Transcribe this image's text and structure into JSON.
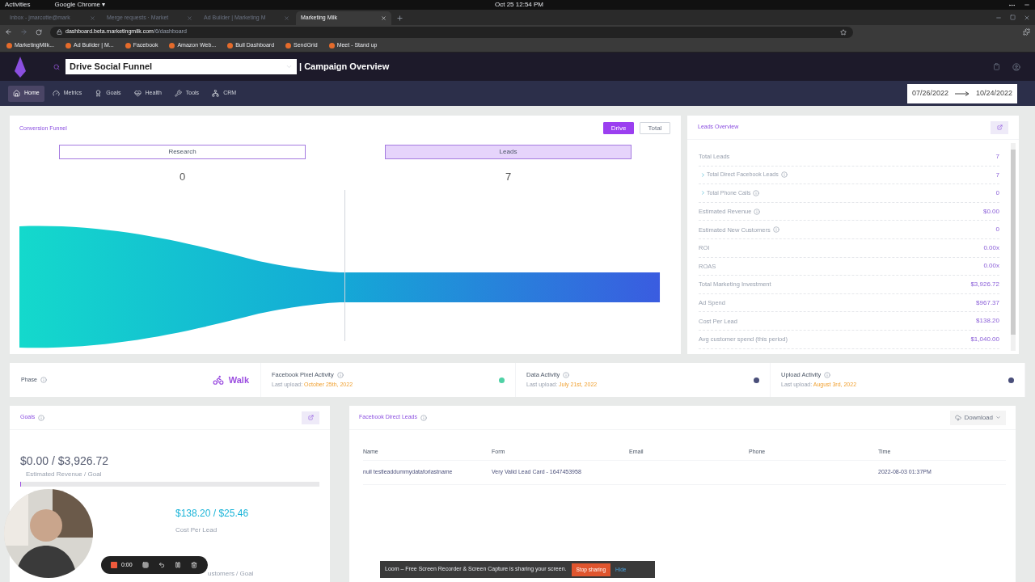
{
  "os_bar": {
    "activities": "Activities",
    "app": "Google Chrome",
    "app_caret": "▾",
    "clock": "Oct 25  12:54 PM"
  },
  "browser": {
    "tabs": [
      {
        "label": "Inbox - jmarcotte@mark",
        "selected": false
      },
      {
        "label": "Merge requests · Market",
        "selected": false
      },
      {
        "label": "Ad Builder | Marketing M",
        "selected": false
      },
      {
        "label": "Marketing Milk",
        "selected": true
      }
    ],
    "url_host": "dashboard.beta.marketingmilk.com",
    "url_path": "/6/dashboard",
    "bookmarks": [
      "MarketingMilk...",
      "Ad Builder | M...",
      "Facebook",
      "Amazon Web...",
      "Bull Dashboard",
      "SendGrid",
      "Meet - Stand up"
    ]
  },
  "header": {
    "funnel_select": "Drive Social Funnel",
    "page_title": "| Campaign Overview"
  },
  "nav": [
    {
      "label": "Home",
      "selected": true
    },
    {
      "label": "Metrics",
      "selected": false
    },
    {
      "label": "Goals",
      "selected": false
    },
    {
      "label": "Health",
      "selected": false
    },
    {
      "label": "Tools",
      "selected": false
    },
    {
      "label": "CRM",
      "selected": false
    }
  ],
  "date_range": {
    "start": "07/26/2022",
    "end": "10/24/2022"
  },
  "conversion_funnel": {
    "title": "Conversion Funnel",
    "toggle": [
      {
        "label": "Drive",
        "selected": true
      },
      {
        "label": "Total",
        "selected": false
      }
    ],
    "stages": [
      {
        "label": "Research",
        "value": "0",
        "selected": false
      },
      {
        "label": "Leads",
        "value": "7",
        "selected": true
      }
    ]
  },
  "leads_overview": {
    "title": "Leads Overview",
    "rows": [
      {
        "label": "Total Leads",
        "value": "7",
        "kind": "main",
        "info": false
      },
      {
        "label": "Total Direct Facebook Leads",
        "value": "7",
        "kind": "sub",
        "info": true
      },
      {
        "label": "Total Phone Calls",
        "value": "0",
        "kind": "sub",
        "info": true
      },
      {
        "label": "Estimated Revenue",
        "value": "$0.00",
        "kind": "main",
        "info": true
      },
      {
        "label": "Estimated New Customers",
        "value": "0",
        "kind": "main",
        "info": true
      },
      {
        "label": "ROI",
        "value": "0.00x",
        "kind": "main",
        "info": false
      },
      {
        "label": "ROAS",
        "value": "0.00x",
        "kind": "main",
        "info": false
      },
      {
        "label": "Total Marketing Investment",
        "value": "$3,926.72",
        "kind": "main",
        "info": false
      },
      {
        "label": "Ad Spend",
        "value": "$967.37",
        "kind": "main",
        "info": false
      },
      {
        "label": "Cost Per Lead",
        "value": "$138.20",
        "kind": "main",
        "info": false
      },
      {
        "label": "Avg customer spend (this period)",
        "value": "$1,040.00",
        "kind": "main",
        "info": false
      }
    ]
  },
  "activity": {
    "phase": {
      "label": "Phase",
      "value": "Walk"
    },
    "items": [
      {
        "title": "Facebook Pixel Activity",
        "prefix": "Last upload:",
        "date": "October 25th, 2022",
        "color": "#4fd1a5"
      },
      {
        "title": "Data Activity",
        "prefix": "Last upload:",
        "date": "July 21st, 2022",
        "color": "#4a4f7a"
      },
      {
        "title": "Upload Activity",
        "prefix": "Last upload:",
        "date": "August 3rd, 2022",
        "color": "#4a4f7a"
      }
    ]
  },
  "goals": {
    "title": "Goals",
    "revenue": {
      "value": "$0.00 / $3,926.72",
      "caption": "Estimated Revenue / Goal",
      "level": 0
    },
    "cost": {
      "value": "$138.20 / $25.46",
      "caption": "Cost Per Lead"
    },
    "partial_caption": "ustomers / Goal"
  },
  "facebook_leads": {
    "title": "Facebook Direct Leads",
    "download": "Download",
    "columns": [
      "Name",
      "Form",
      "Email",
      "Phone",
      "Time"
    ],
    "rows": [
      {
        "name": "null testleaddummydataforlastname",
        "form": "Very Valid Lead Card - 1647453958",
        "time": "2022-08-03 01:37PM"
      }
    ]
  },
  "recorder": {
    "time": "0:00"
  },
  "loom_banner": {
    "message": "Loom – Free Screen Recorder & Screen Capture is sharing your screen.",
    "stop": "Stop sharing",
    "hide": "Hide"
  }
}
